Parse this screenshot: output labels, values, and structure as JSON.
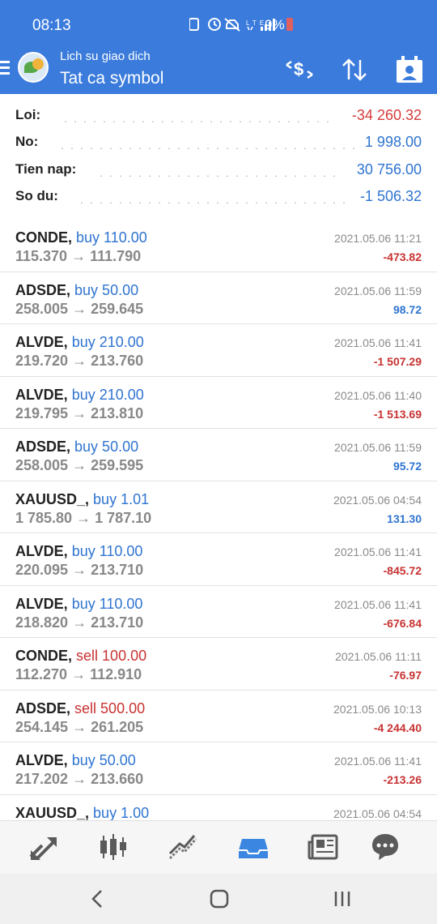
{
  "status_bar": {
    "time": "08:13",
    "battery": "9%"
  },
  "header": {
    "subtitle": "Lich su giao dich",
    "title": "Tat ca symbol"
  },
  "summary": [
    {
      "label": "Loi:",
      "value": "-34 260.32",
      "color": "#d43c3c"
    },
    {
      "label": "No:",
      "value": "1 998.00",
      "color": "#2f74d0"
    },
    {
      "label": "Tien nap:",
      "value": "30 756.00",
      "color": "#2f74d0"
    },
    {
      "label": "So du:",
      "value": "-1 506.32",
      "color": "#2f74d0"
    }
  ],
  "colors": {
    "accent": "#3a7bdc",
    "buy": "#2f74d0",
    "sell": "#c83232",
    "profit_positive": "#2f74d0",
    "profit_negative": "#c83232"
  },
  "trades": [
    {
      "symbol": "CONDE,",
      "side": "buy",
      "volume": "buy 110.00",
      "prices": "115.370 → 111.790",
      "date": "2021.05.06 11:21",
      "profit": "-473.82"
    },
    {
      "symbol": "ADSDE,",
      "side": "buy",
      "volume": "buy 50.00",
      "prices": "258.005 → 259.645",
      "date": "2021.05.06 11:59",
      "profit": "98.72"
    },
    {
      "symbol": "ALVDE,",
      "side": "buy",
      "volume": "buy 210.00",
      "prices": "219.720 → 213.760",
      "date": "2021.05.06 11:41",
      "profit": "-1 507.29"
    },
    {
      "symbol": "ALVDE,",
      "side": "buy",
      "volume": "buy 210.00",
      "prices": "219.795 → 213.810",
      "date": "2021.05.06 11:40",
      "profit": "-1 513.69"
    },
    {
      "symbol": "ADSDE,",
      "side": "buy",
      "volume": "buy 50.00",
      "prices": "258.005 → 259.595",
      "date": "2021.05.06 11:59",
      "profit": "95.72"
    },
    {
      "symbol": "XAUUSD_,",
      "side": "buy",
      "volume": "buy 1.01",
      "prices": "1 785.80 → 1 787.10",
      "date": "2021.05.06 04:54",
      "profit": "131.30"
    },
    {
      "symbol": "ALVDE,",
      "side": "buy",
      "volume": "buy 110.00",
      "prices": "220.095 → 213.710",
      "date": "2021.05.06 11:41",
      "profit": "-845.72"
    },
    {
      "symbol": "ALVDE,",
      "side": "buy",
      "volume": "buy 110.00",
      "prices": "218.820 → 213.710",
      "date": "2021.05.06 11:41",
      "profit": "-676.84"
    },
    {
      "symbol": "CONDE,",
      "side": "sell",
      "volume": "sell 100.00",
      "prices": "112.270 → 112.910",
      "date": "2021.05.06 11:11",
      "profit": "-76.97"
    },
    {
      "symbol": "ADSDE,",
      "side": "sell",
      "volume": "sell 500.00",
      "prices": "254.145 → 261.205",
      "date": "2021.05.06 10:13",
      "profit": "-4 244.40"
    },
    {
      "symbol": "ALVDE,",
      "side": "buy",
      "volume": "buy 50.00",
      "prices": "217.202 → 213.660",
      "date": "2021.05.06 11:41",
      "profit": "-213.26"
    },
    {
      "symbol": "XAUUSD_,",
      "side": "buy",
      "volume": "buy 1.00",
      "prices": "",
      "date": "2021.05.06 04:54",
      "profit": ""
    }
  ],
  "tabs": [
    {
      "icon": "quotes-icon"
    },
    {
      "icon": "chart-icon"
    },
    {
      "icon": "trade-icon"
    },
    {
      "icon": "history-icon",
      "active": true
    },
    {
      "icon": "news-icon"
    },
    {
      "icon": "chat-icon"
    }
  ]
}
